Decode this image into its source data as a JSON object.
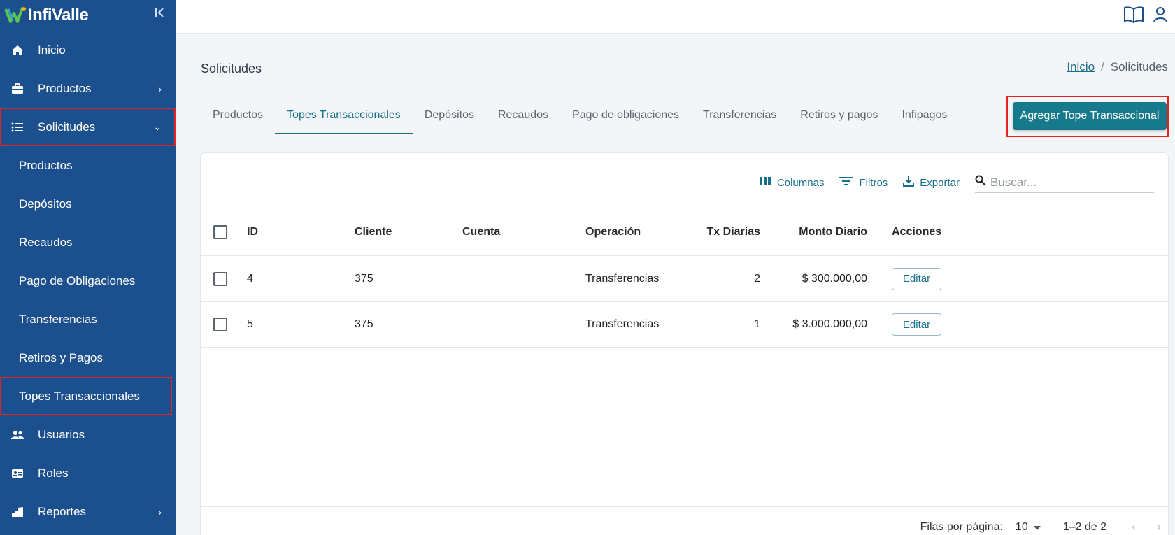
{
  "brand": {
    "name": "InfiValle"
  },
  "sidebar": {
    "items": [
      {
        "label": "Inicio"
      },
      {
        "label": "Productos"
      },
      {
        "label": "Solicitudes"
      },
      {
        "label": "Usuarios"
      },
      {
        "label": "Roles"
      },
      {
        "label": "Reportes"
      }
    ],
    "sub_items": [
      {
        "label": "Productos"
      },
      {
        "label": "Depósitos"
      },
      {
        "label": "Recaudos"
      },
      {
        "label": "Pago de Obligaciones"
      },
      {
        "label": "Transferencias"
      },
      {
        "label": "Retiros y Pagos"
      },
      {
        "label": "Topes Transaccionales"
      }
    ]
  },
  "header": {
    "title": "Solicitudes",
    "breadcrumb": {
      "home": "Inicio",
      "sep": "/",
      "current": "Solicitudes"
    }
  },
  "tabs": [
    {
      "label": "Productos"
    },
    {
      "label": "Topes Transaccionales"
    },
    {
      "label": "Depósitos"
    },
    {
      "label": "Recaudos"
    },
    {
      "label": "Pago de obligaciones"
    },
    {
      "label": "Transferencias"
    },
    {
      "label": "Retiros y pagos"
    },
    {
      "label": "Infipagos"
    }
  ],
  "add_button": "Agregar Tope Transaccional",
  "toolbar": {
    "columns": "Columnas",
    "filters": "Filtros",
    "export": "Exportar",
    "search_placeholder": "Buscar..."
  },
  "table": {
    "headers": [
      "ID",
      "Cliente",
      "Cuenta",
      "Operación",
      "Tx Diarias",
      "Monto Diario",
      "Acciones"
    ],
    "rows": [
      {
        "id": "4",
        "cliente": "375",
        "cuenta": "",
        "operacion": "Transferencias",
        "tx": "2",
        "monto": "$ 300.000,00",
        "accion": "Editar"
      },
      {
        "id": "5",
        "cliente": "375",
        "cuenta": "",
        "operacion": "Transferencias",
        "tx": "1",
        "monto": "$ 3.000.000,00",
        "accion": "Editar"
      }
    ]
  },
  "pagination": {
    "rows_label": "Filas por página:",
    "rows_value": "10",
    "range": "1–2 de 2"
  },
  "colors": {
    "sidebar": "#1c4f8e",
    "accent": "#177a8c",
    "highlight": "#e32424"
  }
}
